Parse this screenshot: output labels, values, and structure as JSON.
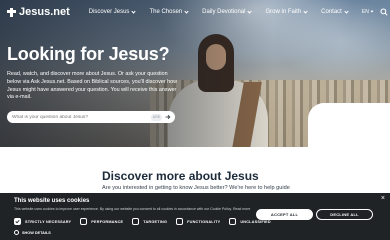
{
  "brand": {
    "name": "Jesus.net"
  },
  "nav": {
    "items": [
      {
        "label": "Discover Jesus"
      },
      {
        "label": "The Chosen"
      },
      {
        "label": "Daily Devotional"
      },
      {
        "label": "Grow in Faith"
      },
      {
        "label": "Contact"
      }
    ],
    "language": "EN",
    "icons": [
      "search-icon",
      "menu-icon"
    ]
  },
  "hero": {
    "title": "Looking for Jesus?",
    "text": "Read, watch, and discover more about Jesus. Or ask your question below via Ask Jesus.net. Based on Biblical sources, you'll discover how Jesus might have answered your question. You will receive this answer via e-mail.",
    "search_placeholder": "What is your question about Jesus?",
    "ask_label": "ASK"
  },
  "discover": {
    "title": "Discover more about Jesus",
    "subtitle": "Are you interested in getting to know Jesus better? We're here to help guide"
  },
  "cookie": {
    "title": "This website uses cookies",
    "text": "This website uses cookies to improve user experience. By using our website you consent to all cookies in accordance with our Cookie Policy.  Read more",
    "options": [
      {
        "label": "STRICTLY NECESSARY",
        "checked": true
      },
      {
        "label": "PERFORMANCE",
        "checked": false
      },
      {
        "label": "TARGETING",
        "checked": false
      },
      {
        "label": "FUNCTIONALITY",
        "checked": false
      },
      {
        "label": "UNCLASSIFIED",
        "checked": false
      }
    ],
    "show_details": "SHOW DETAILS",
    "accept_label": "ACCEPT ALL",
    "decline_label": "DECLINE ALL",
    "close_symbol": "×"
  },
  "colors": {
    "banner_bg": "#1f2326",
    "heading": "#1c2b3a"
  }
}
